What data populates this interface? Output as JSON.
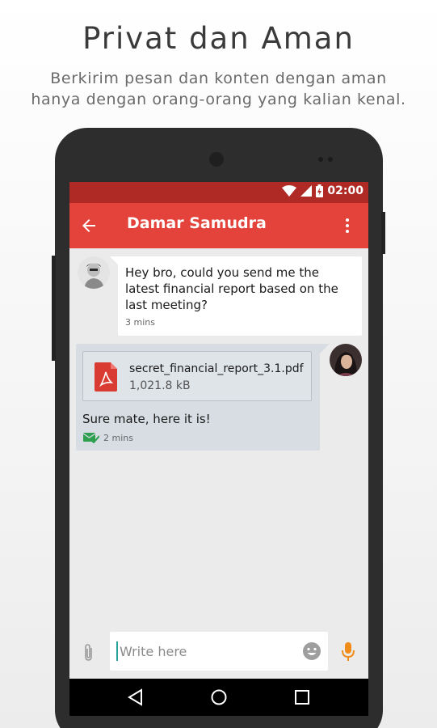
{
  "promo": {
    "title": "Privat dan Aman",
    "subtitle_line1": "Berkirim pesan dan konten dengan aman",
    "subtitle_line2": "hanya dengan orang-orang yang kalian kenal."
  },
  "status_bar": {
    "time": "02:00"
  },
  "app_bar": {
    "contact_name": "Damar Samudra"
  },
  "messages": {
    "incoming": {
      "text": "Hey bro, could you send me the latest financial report based on the last meeting?",
      "time": "3 mins"
    },
    "outgoing": {
      "attachment": {
        "file_name": "secret_financial_report_3.1.pdf",
        "file_size": "1,021.8  kB"
      },
      "text": "Sure mate, here it is!",
      "time": "2 mins"
    }
  },
  "composer": {
    "placeholder": "Write here"
  },
  "colors": {
    "status_bar": "#b02a25",
    "app_bar": "#e3433b",
    "accent_mic": "#f08c1a",
    "delivered": "#2e9e4f"
  },
  "icons": {
    "back": "arrow-left-icon",
    "more": "more-vert-icon",
    "pdf": "pdf-file-icon",
    "delivered": "delivered-check-icon",
    "attach": "paperclip-icon",
    "emoji": "emoji-icon",
    "mic": "microphone-icon"
  }
}
